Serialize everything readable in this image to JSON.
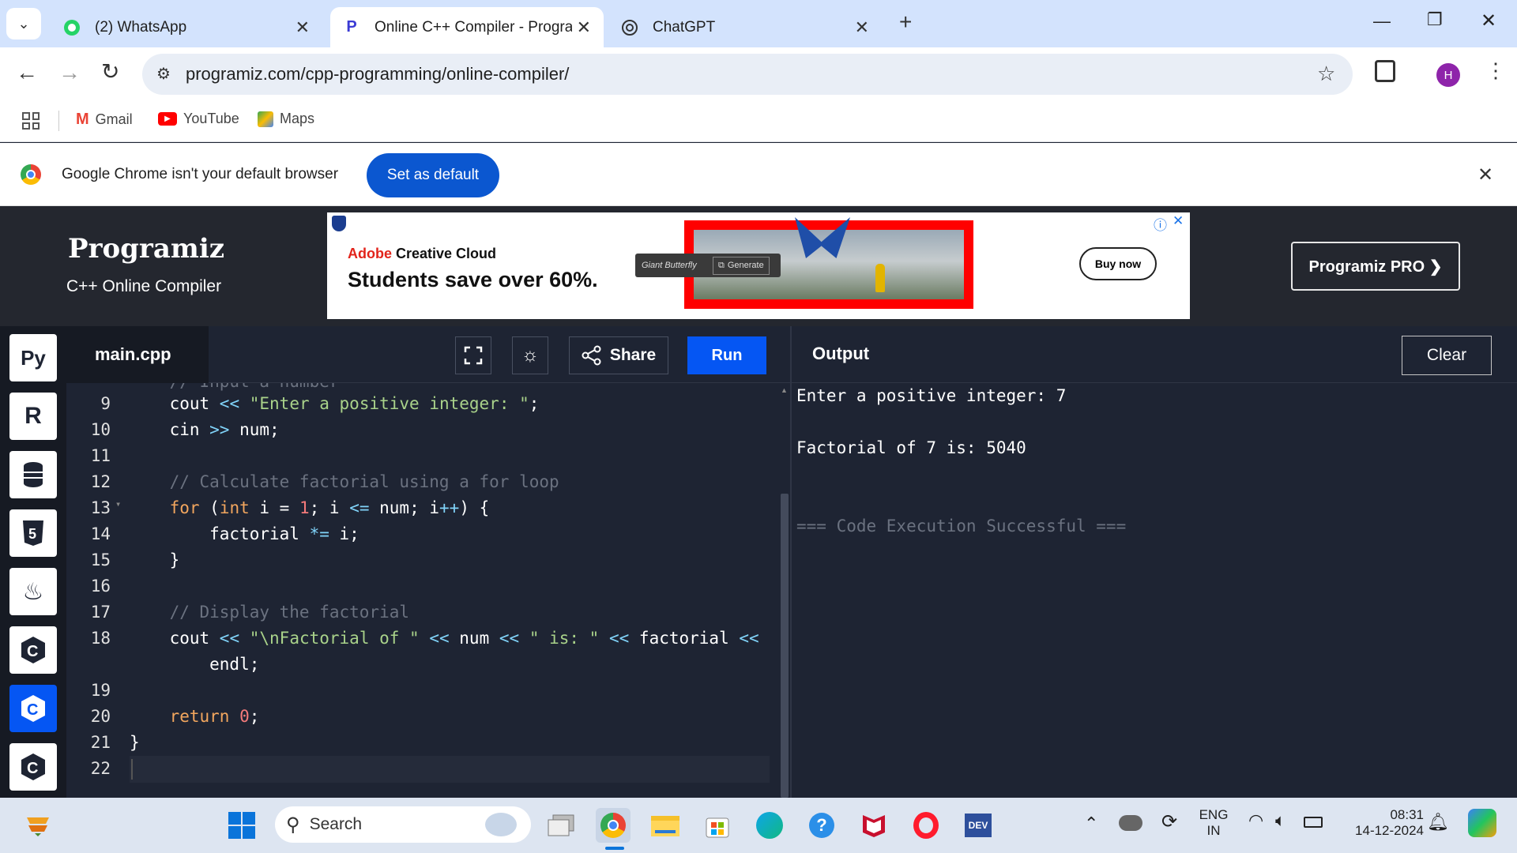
{
  "tabs": [
    {
      "title": "(2) WhatsApp",
      "icon": "whatsapp-icon"
    },
    {
      "title": "Online C++ Compiler - Programiz",
      "icon": "programiz-icon",
      "active": true
    },
    {
      "title": "ChatGPT",
      "icon": "chatgpt-icon"
    }
  ],
  "window": {
    "new_tab": "+",
    "minimize": "—",
    "restore": "❐",
    "close": "✕"
  },
  "toolbar": {
    "url": "programiz.com/cpp-programming/online-compiler/",
    "profile_initial": "H"
  },
  "bookmarks": [
    {
      "label": "Gmail",
      "icon": "gmail-icon"
    },
    {
      "label": "YouTube",
      "icon": "youtube-icon"
    },
    {
      "label": "Maps",
      "icon": "maps-icon"
    }
  ],
  "infobar": {
    "message": "Google Chrome isn't your default browser",
    "button": "Set as default"
  },
  "header": {
    "logo": "Programiz",
    "subtitle": "C++ Online Compiler",
    "pro_button": "Programiz PRO ❯"
  },
  "ad": {
    "brand": "Adobe",
    "product": "Creative Cloud",
    "headline": "Students save over 60%.",
    "prompt_text": "Giant Butterfly",
    "generate": "Generate",
    "buy": "Buy now",
    "info": "ⓘ",
    "close": "✕"
  },
  "editor": {
    "file": "main.cpp",
    "share": "Share",
    "run": "Run",
    "lines": [
      {
        "n": "9",
        "text": "    cout << \"Enter a positive integer: \";"
      },
      {
        "n": "10",
        "text": "    cin >> num;"
      },
      {
        "n": "11",
        "text": ""
      },
      {
        "n": "12",
        "text": "    // Calculate factorial using a for loop"
      },
      {
        "n": "13",
        "text": "    for (int i = 1; i <= num; i++) {"
      },
      {
        "n": "14",
        "text": "        factorial *= i;"
      },
      {
        "n": "15",
        "text": "    }"
      },
      {
        "n": "16",
        "text": ""
      },
      {
        "n": "17",
        "text": "    // Display the factorial"
      },
      {
        "n": "18",
        "text": "    cout << \"\\nFactorial of \" << num << \" is: \" << factorial <<"
      },
      {
        "n": "",
        "text": "        endl;"
      },
      {
        "n": "19",
        "text": ""
      },
      {
        "n": "20",
        "text": "    return 0;"
      },
      {
        "n": "21",
        "text": "}"
      },
      {
        "n": "22",
        "text": ""
      }
    ]
  },
  "output": {
    "title": "Output",
    "clear": "Clear",
    "lines": [
      "Enter a positive integer: 7",
      "",
      "Factorial of 7 is: 5040",
      "",
      "",
      "=== Code Execution Successful ==="
    ]
  },
  "taskbar": {
    "search_placeholder": "Search",
    "lang_top": "ENG",
    "lang_bottom": "IN",
    "time": "08:31",
    "date": "14-12-2024"
  }
}
